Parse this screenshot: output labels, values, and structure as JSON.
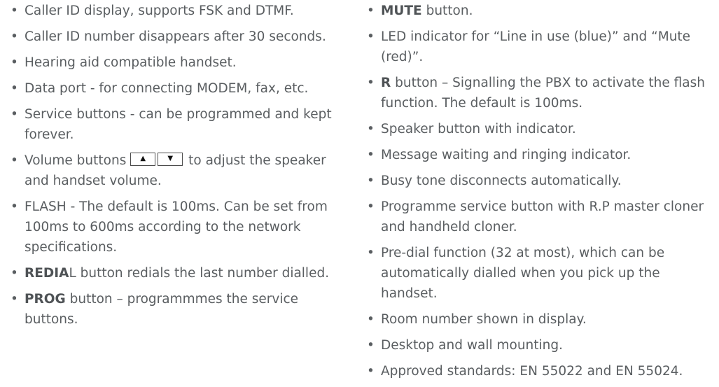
{
  "left_column": {
    "items": [
      {
        "text": "Caller ID display, supports FSK and DTMF."
      },
      {
        "text": "Caller ID number disappears after 30 seconds."
      },
      {
        "text": "Hearing aid compatible handset."
      },
      {
        "text": "Data port - for connecting MODEM, fax, etc."
      },
      {
        "text": "Service buttons - can be programmed and kept forever."
      },
      {
        "pre": "Volume buttons",
        "key_up_icon": "triangle-up",
        "key_down_icon": "triangle-down",
        "post": "to adjust the speaker and handset volume."
      },
      {
        "text": "FLASH - The default is 100ms. Can be set from 100ms to 600ms according to the network specifications."
      },
      {
        "bold": "REDIA",
        "text": "L button redials the last number dialled."
      },
      {
        "bold": "PROG",
        "text": " button – programmmes the service buttons."
      }
    ]
  },
  "right_column": {
    "items": [
      {
        "bold": "MUTE",
        "text": " button."
      },
      {
        "text": "LED indicator for “Line in use (blue)” and “Mute (red)”."
      },
      {
        "bold": "R",
        "text": " button – Signalling the PBX to activate the flash function. The default is 100ms."
      },
      {
        "text": "Speaker button with indicator."
      },
      {
        "text": "Message waiting and ringing indicator."
      },
      {
        "text": "Busy tone disconnects automatically."
      },
      {
        "text": "Programme service button with R.P master cloner and handheld cloner."
      },
      {
        "text": "Pre-dial function (32 at most), which can be automatically dialled when you pick up the handset."
      },
      {
        "text": "Room number shown in display."
      },
      {
        "text": "Desktop and wall mounting."
      },
      {
        "text": "Approved standards: EN 55022 and EN 55024."
      }
    ]
  },
  "bullet_glyph": "•",
  "colors": {
    "text": "#5a5e61",
    "key_border": "#4d4d4d"
  }
}
